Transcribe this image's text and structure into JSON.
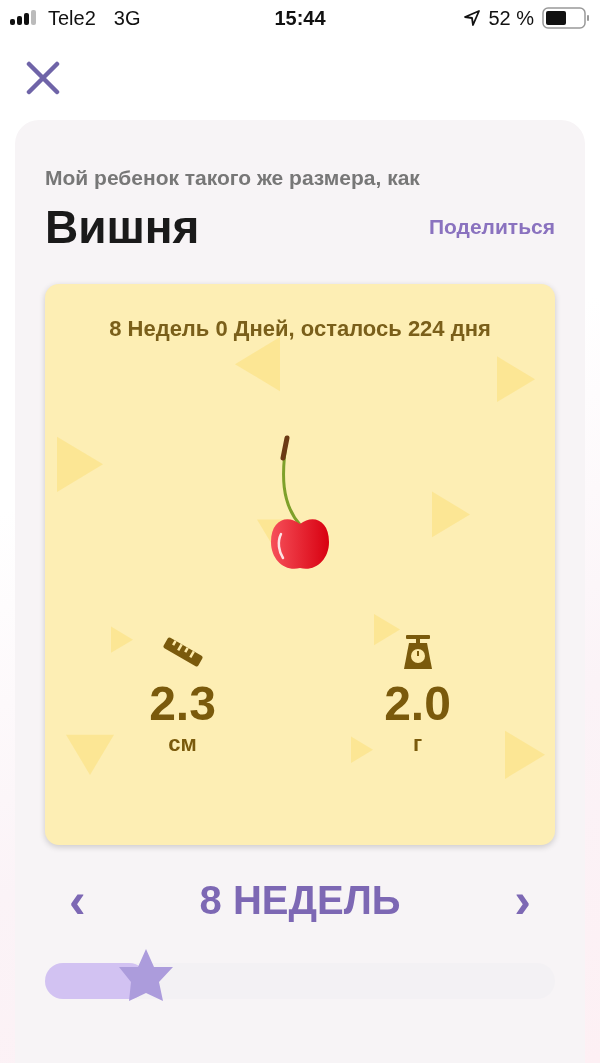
{
  "status_bar": {
    "carrier": "Tele2",
    "network": "3G",
    "time": "15:44",
    "battery": "52 %"
  },
  "subtitle": "Мой ребенок такого же размера, как",
  "title": "Вишня",
  "share_link": "Поделиться",
  "card": {
    "age": "8 Недель 0 Дней, осталось 224 дня",
    "stats": [
      {
        "kind": "length",
        "value": "2.3",
        "unit": "см"
      },
      {
        "kind": "weight",
        "value": "2.0",
        "unit": "г"
      }
    ]
  },
  "week_nav": {
    "label": "8 НЕДЕЛЬ",
    "prev": "‹",
    "next": "›"
  },
  "progress": {
    "level": 0.2
  }
}
